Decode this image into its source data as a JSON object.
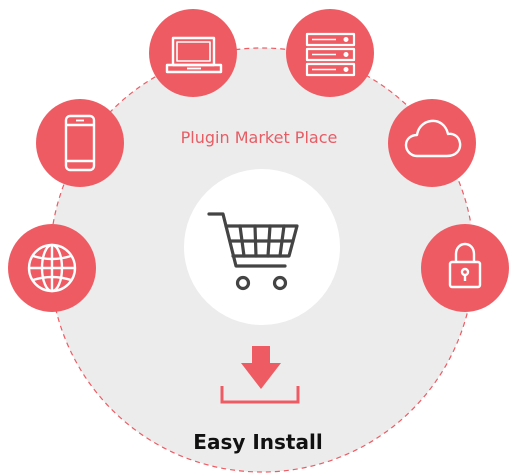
{
  "title": "Plugin Market Place",
  "caption": "Easy Install",
  "colors": {
    "accent": "#ef5b63",
    "ring_fill": "#ececed",
    "ring_stroke": "#ef5b63",
    "icon_stroke": "#ffffff",
    "cart": "#444444",
    "text_dark": "#111111"
  },
  "icons": {
    "globe": "globe-icon",
    "phone": "smartphone-icon",
    "laptop": "laptop-icon",
    "server": "server-icon",
    "cloud": "cloud-icon",
    "lock": "lock-icon",
    "cart": "shopping-cart-icon",
    "install": "download-arrow-icon"
  }
}
